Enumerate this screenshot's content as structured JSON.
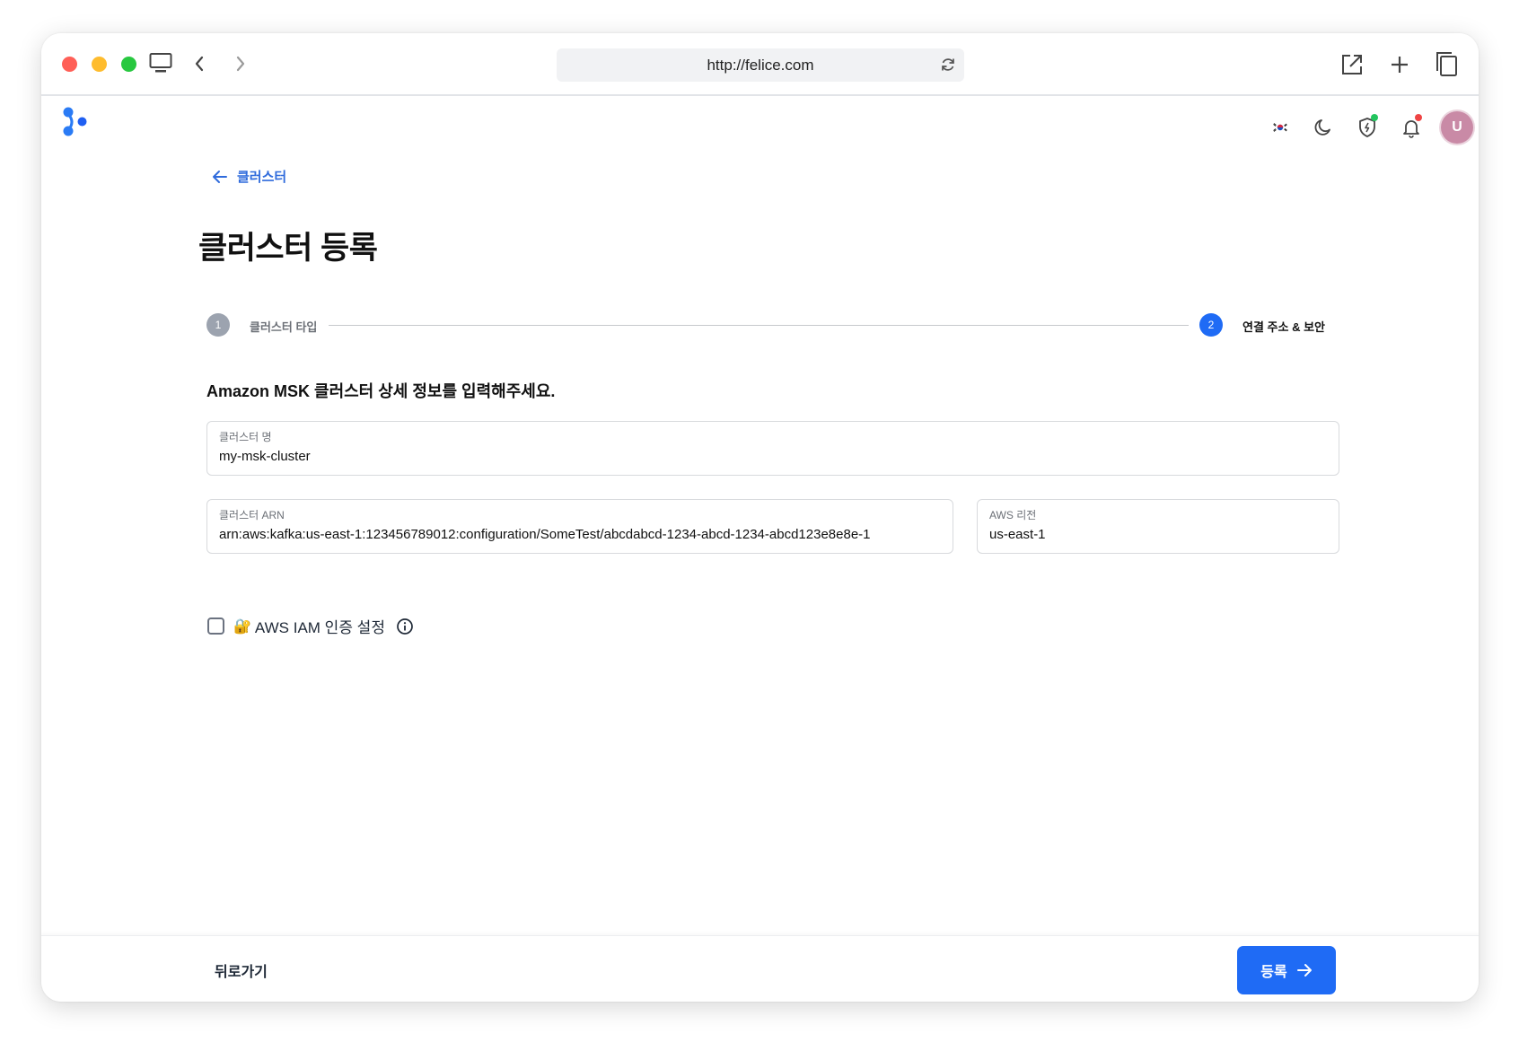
{
  "browser": {
    "url": "http://felice.com"
  },
  "topbar": {
    "avatar_initial": "U",
    "shield_badge_color": "#22c55e",
    "bell_badge_color": "#ef4444"
  },
  "nav": {
    "back_label": "클러스터"
  },
  "page": {
    "title": "클러스터 등록"
  },
  "stepper": {
    "steps": [
      {
        "number": "1",
        "label": "클러스터 타입",
        "state": "completed"
      },
      {
        "number": "2",
        "label": "연결 주소 & 보안",
        "state": "active"
      }
    ]
  },
  "form": {
    "section_title": "Amazon MSK 클러스터 상세 정보를 입력해주세요.",
    "cluster_name": {
      "label": "클러스터 명",
      "value": "my-msk-cluster"
    },
    "cluster_arn": {
      "label": "클러스터 ARN",
      "value": "arn:aws:kafka:us-east-1:123456789012:configuration/SomeTest/abcdabcd-1234-abcd-1234-abcd123e8e8e-1"
    },
    "aws_region": {
      "label": "AWS 리전",
      "value": "us-east-1"
    },
    "iam_auth": {
      "label": "AWS IAM 인증 설정",
      "icon": "🔐",
      "checked": false
    }
  },
  "footer": {
    "back_label": "뒤로가기",
    "submit_label": "등록"
  },
  "colors": {
    "accent": "#1f6bf5",
    "link": "#2f6bdc",
    "step_completed": "#9ca3af"
  }
}
